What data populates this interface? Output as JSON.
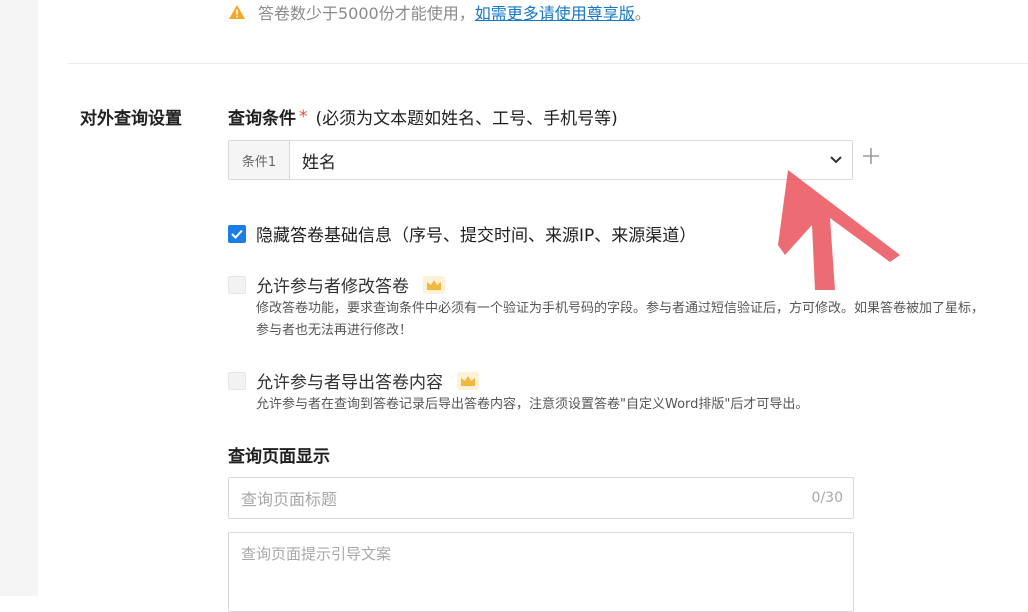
{
  "notice": {
    "text": "答卷数少于5000份才能使用，",
    "link": "如需更多请使用尊享版",
    "suffix": "。",
    "icon": "warning-icon",
    "warn_color": "#f5a623"
  },
  "section": {
    "label": "对外查询设置"
  },
  "query_condition": {
    "title": "查询条件",
    "required_mark": "*",
    "hint": "(必须为文本题如姓名、工号、手机号等)",
    "condition_tag": "条件1",
    "selected_value": "姓名"
  },
  "options": [
    {
      "label": "隐藏答卷基础信息（序号、提交时间、来源IP、来源渠道）",
      "checked": true
    },
    {
      "label": "允许参与者修改答卷",
      "checked": false,
      "premium": true,
      "description": "修改答卷功能，要求查询条件中必须有一个验证为手机号码的字段。参与者通过短信验证后，方可修改。如果答卷被加了星标，参与者也无法再进行修改！"
    },
    {
      "label": "允许参与者导出答卷内容",
      "checked": false,
      "premium": true,
      "description": "允许参与者在查询到答卷记录后导出答卷内容，注意须设置答卷\"自定义Word排版\"后才可导出。"
    }
  ],
  "query_page": {
    "title": "查询页面显示",
    "title_placeholder": "查询页面标题",
    "title_counter": "0/30",
    "guide_placeholder": "查询页面提示引导文案"
  },
  "colors": {
    "accent": "#1a7ee6",
    "link": "#1677c8",
    "required": "#e54d42",
    "annotation_arrow": "#e8414a"
  }
}
